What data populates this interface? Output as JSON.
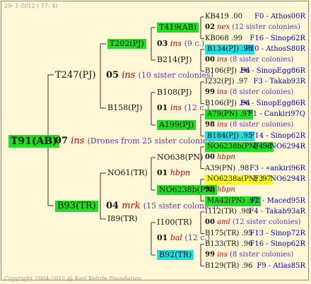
{
  "header": "29-  1-2012 ( 17:  4)",
  "footer": "Copyright 2004-2012 @ Karl Kehrle Foundation",
  "root": {
    "label": "T91(AB)",
    "gen": "07",
    "mark": "ins",
    "note": "(Drones from 25 sister colonies)"
  },
  "l1": [
    {
      "label": "T247(PJ)",
      "gen": "05",
      "mark": "ins",
      "note": "(10 sister colonies)"
    },
    {
      "label": "B93(TR)",
      "gen": "04",
      "mark": "mrk",
      "note": "(15 sister colonies)"
    }
  ],
  "l2": [
    {
      "label": "T202(PJ)",
      "gen": "03",
      "mark": "ins",
      "note": "(9 c.)"
    },
    {
      "label": "B158(PJ)",
      "gen": "01",
      "mark": "ins",
      "note": "(12 c.)"
    },
    {
      "label": "NO61(TR)",
      "gen": "01",
      "mark": "hbpn",
      "note": ""
    },
    {
      "label": "I89(TR)",
      "gen": "01",
      "mark": "bal",
      "note": "(12 c.)"
    }
  ],
  "l3": [
    {
      "label": "T419(AB)"
    },
    {
      "label": "B214(PJ)"
    },
    {
      "label": "B108(PJ)"
    },
    {
      "label": "A199(PJ)"
    },
    {
      "label": "NO638(PN)"
    },
    {
      "label": "NO6238b(PN)"
    },
    {
      "label": "I100(TR)"
    },
    {
      "label": "B92(TR)"
    }
  ],
  "rows": [
    {
      "name": "KB419 .00",
      "right": "F0 - Athos00R"
    },
    {
      "gen": "02",
      "mark": "nex",
      "note": "(12 sister colonies)"
    },
    {
      "name": "KB068 .99",
      "right": "F16 - Sinop62R"
    },
    {
      "name": "B134(PJ) .98",
      "right": "F10 - AthosS80R"
    },
    {
      "gen": "00",
      "mark": "ins",
      "note": "(8 sister colonies)"
    },
    {
      "name": "B106(PJ) .94",
      "right": "F6 - SinopEgg86R"
    },
    {
      "name": "I232(PJ) .97",
      "right": "F3 - Takab93R"
    },
    {
      "gen": "99",
      "mark": "ins",
      "note": "(8 sister colonies)"
    },
    {
      "name": "B106(PJ) .94",
      "right": "F6 - SinopEgg86R"
    },
    {
      "name": "A79(PN) .97",
      "right": "F1 - Cankiri97Q"
    },
    {
      "gen": "98",
      "mark": "ins",
      "note": "(8 sister colonies)"
    },
    {
      "name": "B184(PJ) .95",
      "right": "F14 - Sinop62R"
    },
    {
      "name": "NO6238b(PN) .98",
      "right": "F4 - NO6294R"
    },
    {
      "gen": "00",
      "mark": "hbpn",
      "note": ""
    },
    {
      "name": "A39(PN) .98",
      "right": "F3 - «ankiri96R"
    },
    {
      "name": "NO6238a(PN) .97",
      "right": "F3 - NO6294R"
    },
    {
      "gen": "98",
      "mark": "hbpn",
      "note": ""
    },
    {
      "name": "MA42(PN) .97",
      "right": "F2 - Maced95R"
    },
    {
      "name": "I112(TR) .98",
      "right": "F4 - Takab93aR"
    },
    {
      "gen": "00",
      "mark": "aml",
      "note": "(12 sister colonies)"
    },
    {
      "name": "B175(TR) .95",
      "right": "F13 - Sinop72R"
    },
    {
      "name": "B133(TR) .96",
      "right": "F16 - Sinop62R"
    },
    {
      "gen": "99",
      "mark": "ins",
      "note": "(8 sister colonies)"
    },
    {
      "name": "B129(TR) .96",
      "right": "F9 - Atlas85R"
    }
  ]
}
